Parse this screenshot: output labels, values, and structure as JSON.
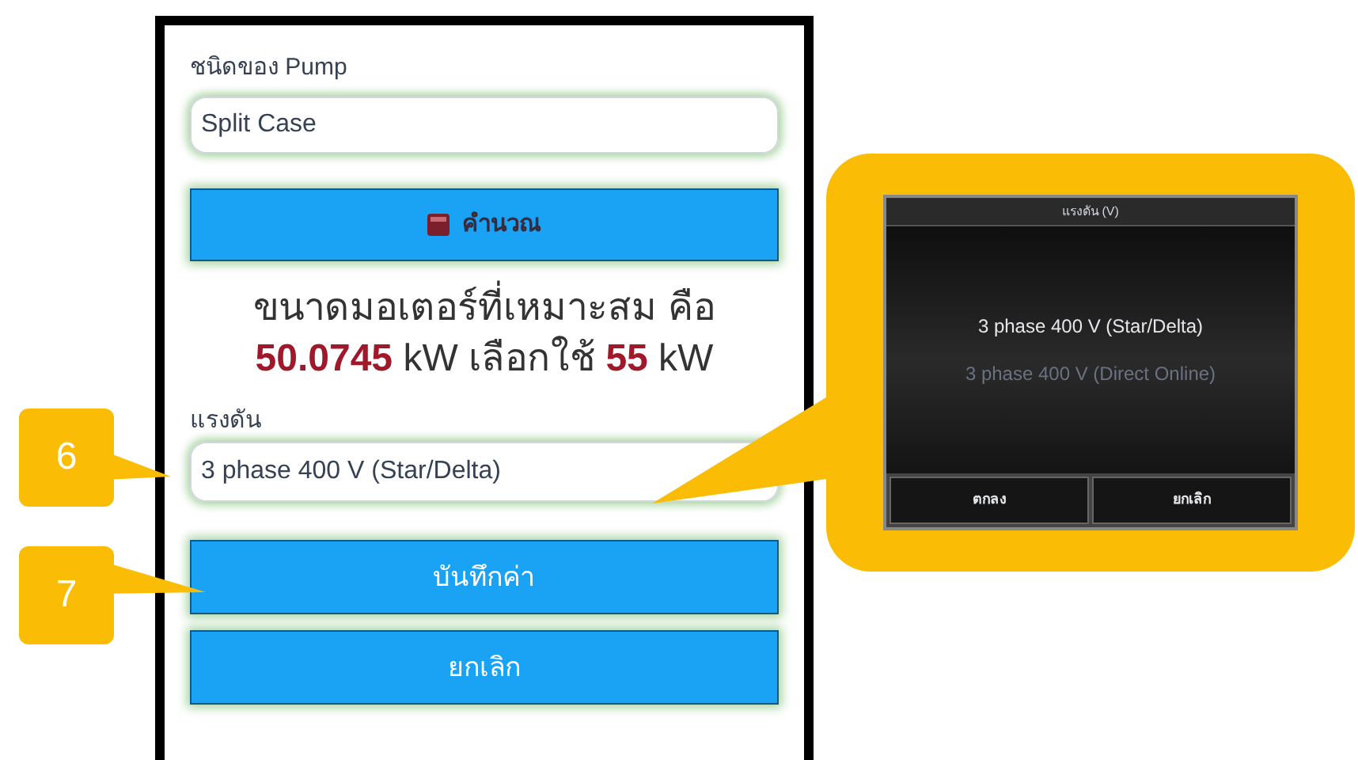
{
  "pump_type": {
    "label": "ชนิดของ Pump",
    "value": "Split Case"
  },
  "calculate_button": {
    "label": "คำนวณ"
  },
  "result": {
    "line_1": "ขนาดมอเตอร์ที่เหมาะสม คือ",
    "line_2": "**50.0745** kW เลือกใช้ **55** kW"
  },
  "voltage": {
    "label": "แรงดัน",
    "value": "3 phase 400 V (Star/Delta)"
  },
  "buttons": [
    "บันทึกค่า",
    "ยกเลิก"
  ],
  "callouts": [
    {
      "label": "6"
    },
    {
      "label": "7"
    }
  ],
  "picker_dialog": {
    "title": "แรงดัน (V)",
    "options": [
      {
        "label": "3 phase 400 V (Star/Delta)",
        "selected": true
      },
      {
        "label": "3 phase 400 V (Direct Online)",
        "selected": false
      }
    ],
    "buttons": [
      "ตกลง",
      "ยกเลิก"
    ]
  }
}
